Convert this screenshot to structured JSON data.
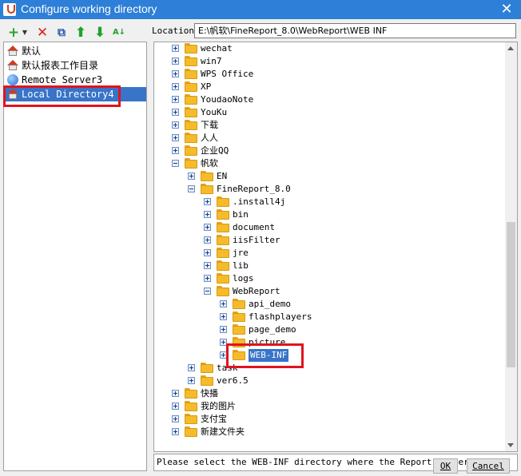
{
  "window": {
    "title": "Configure working directory"
  },
  "toolbar": {
    "add_icon": "plus-icon",
    "delete_icon": "delete-x-icon",
    "copy_icon": "copy-icon",
    "up_icon": "arrow-up-icon",
    "down_icon": "arrow-down-icon",
    "sort_icon": "sort-az-icon"
  },
  "left_list": {
    "items": [
      {
        "label": "默认",
        "icon": "home-icon"
      },
      {
        "label": "默认报表工作目录",
        "icon": "home-icon"
      },
      {
        "label": "Remote Server3",
        "icon": "globe-icon"
      },
      {
        "label": "Local Directory4",
        "icon": "home-icon",
        "selected": true
      }
    ]
  },
  "location": {
    "label": "Location:",
    "value": "E:\\帆软\\FineReport_8.0\\WebReport\\WEB INF"
  },
  "tree": {
    "rows": [
      {
        "label": "wechat",
        "depth": 0,
        "state": "plus"
      },
      {
        "label": "win7",
        "depth": 0,
        "state": "plus"
      },
      {
        "label": "WPS Office",
        "depth": 0,
        "state": "plus"
      },
      {
        "label": "XP",
        "depth": 0,
        "state": "plus"
      },
      {
        "label": "YoudaoNote",
        "depth": 0,
        "state": "plus"
      },
      {
        "label": " YouKu",
        "depth": 0,
        "state": "plus"
      },
      {
        "label": "下载",
        "depth": 0,
        "state": "plus"
      },
      {
        "label": "人人",
        "depth": 0,
        "state": "plus"
      },
      {
        "label": "企业QQ",
        "depth": 0,
        "state": "plus"
      },
      {
        "label": "帆软",
        "depth": 0,
        "state": "minus"
      },
      {
        "label": "EN",
        "depth": 1,
        "state": "plus"
      },
      {
        "label": "FineReport_8.0",
        "depth": 1,
        "state": "minus"
      },
      {
        "label": ".install4j",
        "depth": 2,
        "state": "plus"
      },
      {
        "label": "bin",
        "depth": 2,
        "state": "plus"
      },
      {
        "label": "document",
        "depth": 2,
        "state": "plus"
      },
      {
        "label": "iisFilter",
        "depth": 2,
        "state": "plus"
      },
      {
        "label": "jre",
        "depth": 2,
        "state": "plus"
      },
      {
        "label": "lib",
        "depth": 2,
        "state": "plus"
      },
      {
        "label": "logs",
        "depth": 2,
        "state": "plus"
      },
      {
        "label": "WebReport",
        "depth": 2,
        "state": "minus"
      },
      {
        "label": "api_demo",
        "depth": 3,
        "state": "plus"
      },
      {
        "label": "flashplayers",
        "depth": 3,
        "state": "plus"
      },
      {
        "label": "page_demo",
        "depth": 3,
        "state": "plus"
      },
      {
        "label": "picture",
        "depth": 3,
        "state": "plus"
      },
      {
        "label": "WEB-INF",
        "depth": 3,
        "state": "plus",
        "selected": true
      },
      {
        "label": "task",
        "depth": 1,
        "state": "plus"
      },
      {
        "label": "ver6.5",
        "depth": 1,
        "state": "plus"
      },
      {
        "label": "快播",
        "depth": 0,
        "state": "plus"
      },
      {
        "label": "我的图片",
        "depth": 0,
        "state": "plus"
      },
      {
        "label": "支付宝",
        "depth": 0,
        "state": "plus"
      },
      {
        "label": "新建文件夹",
        "depth": 0,
        "state": "plus"
      }
    ]
  },
  "message": "Please select the WEB-INF directory where the Report Server is in",
  "buttons": {
    "ok": "OK",
    "cancel": "Cancel"
  },
  "colors": {
    "titlebar": "#2d7fd7",
    "selection": "#3874c8",
    "highlight_box": "#e0141e",
    "folder": "#f5bb2a"
  }
}
